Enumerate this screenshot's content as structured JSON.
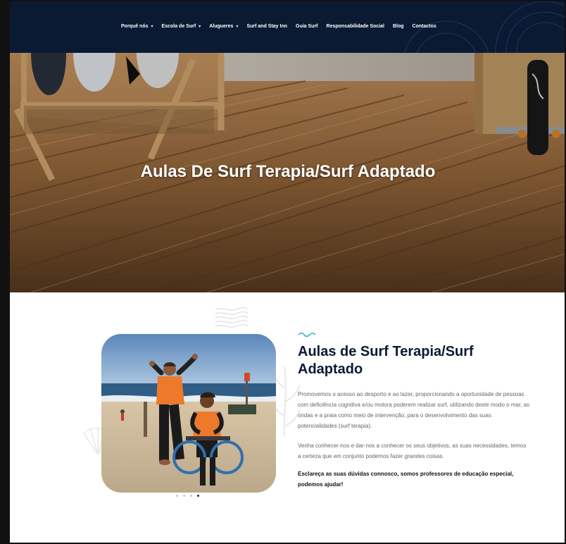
{
  "nav": {
    "items": [
      {
        "label": "Porquê nós",
        "caret": "▾"
      },
      {
        "label": "Escola de Surf",
        "caret": "▾"
      },
      {
        "label": "Alugueres",
        "caret": "▾"
      },
      {
        "label": "Surf and Stay Inn",
        "caret": ""
      },
      {
        "label": "Guia Surf",
        "caret": ""
      },
      {
        "label": "Responsabilidade Social",
        "caret": ""
      },
      {
        "label": "Blog",
        "caret": ""
      },
      {
        "label": "Contactos",
        "caret": ""
      }
    ]
  },
  "hero": {
    "title": "Aulas De Surf Terapia/Surf Adaptado"
  },
  "section": {
    "title": "Aulas de Surf Terapia/Surf Adaptado",
    "paragraph1": "Promovemos o acesso ao desporto e ao lazer, proporcionando a oportunidade de pessoas com deficiência cognitiva e/ou motora poderem realizar surf, utilizando deste modo o mar, as ondas e a praia como meio de intervenção, para o desenvolvimento das suas potencialidades (surf terapia).",
    "paragraph2": "Venha conhecer-nos e dar-nos a conhecer os seus objetivos, as suas necessidades, temos a certeza que em conjunto podemos fazer grandes coisas.",
    "paragraph3": "Esclareça as suas dúvidas connosco, somos professores de educação especial, podemos ajudar!"
  },
  "slider": {
    "count": 4,
    "active_index": 3
  },
  "colors": {
    "navy": "#0b1a33",
    "accent": "#35b6d0",
    "wood": "#a0703f"
  }
}
